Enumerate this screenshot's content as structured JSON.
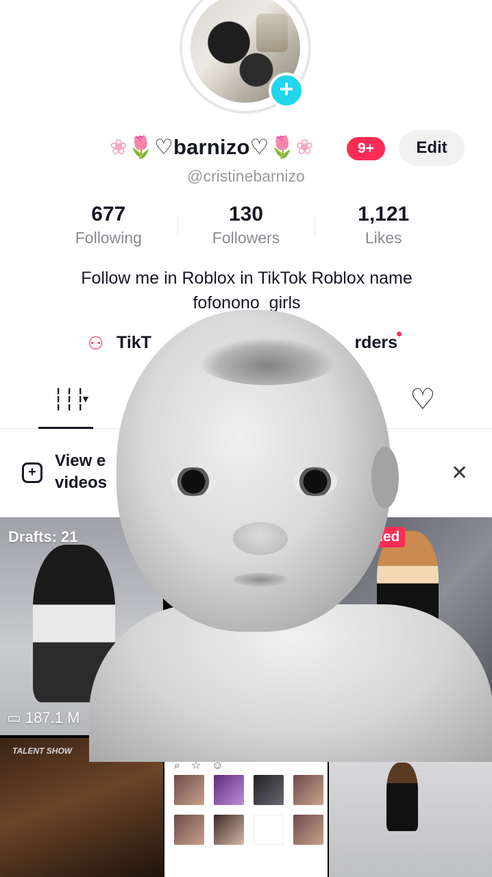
{
  "profile": {
    "display_name_decor_left": "❀🌷",
    "display_name": "♡barnizo♡",
    "display_name_decor_right": "🌷❀",
    "notification_count": "9+",
    "edit_label": "Edit",
    "username": "@cristinebarnizo",
    "add_story_icon": "plus-icon"
  },
  "stats": [
    {
      "value": "677",
      "label": "Following"
    },
    {
      "value": "130",
      "label": "Followers"
    },
    {
      "value": "1,121",
      "label": "Likes"
    }
  ],
  "bio": {
    "line1": "Follow me in Roblox in TikTok Roblox name",
    "line2": "fofonono_girls"
  },
  "links": {
    "left_label": "TikT",
    "right_label": "rders"
  },
  "tabs": {
    "videos_icon": "grid-icon",
    "liked_icon": "heart-outline-icon"
  },
  "banner": {
    "line1": "View e",
    "line2": "videos",
    "close_glyph": "✕"
  },
  "grid": {
    "drafts_label": "Drafts: 21",
    "first_views": "187.1 M",
    "pinned_label": "ned",
    "talent_text": "TALENT SHOW"
  },
  "colors": {
    "accent": "#fe2c55",
    "story_add": "#20d5ec",
    "text_primary": "#161823",
    "text_secondary": "#8a8b91"
  }
}
